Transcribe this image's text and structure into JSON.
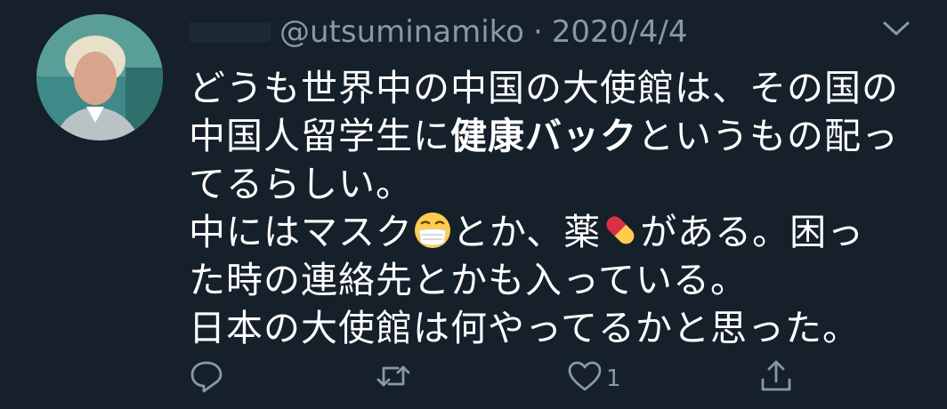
{
  "tweet": {
    "handle": "@utsuminamiko",
    "separator": "·",
    "date": "2020/4/4",
    "lines": [
      {
        "text": "どうも世界中の中国の大使館は、その国の"
      },
      {
        "pre": "中国人留学生に",
        "bold": "健康バック",
        "post": "というもの配っ"
      },
      {
        "text": "てるらしい。"
      },
      {
        "pre": "中にはマスク",
        "mid": "とか、薬",
        "post": "がある。困っ"
      },
      {
        "text": "た時の連絡先とかも入っている。"
      },
      {
        "text": "日本の大使館は何やってるかと思った。"
      }
    ]
  },
  "actions": {
    "like_count": "1"
  },
  "icons": {
    "avatar": "profile-photo",
    "menu": "chevron-down-icon",
    "reply": "reply-icon",
    "retweet": "retweet-icon",
    "like": "heart-icon",
    "share": "share-icon",
    "mask_emoji": "face-with-medical-mask-emoji",
    "pill_emoji": "pill-emoji"
  },
  "colors": {
    "background": "#15202b",
    "text": "#ffffff",
    "muted": "#8899a6"
  }
}
